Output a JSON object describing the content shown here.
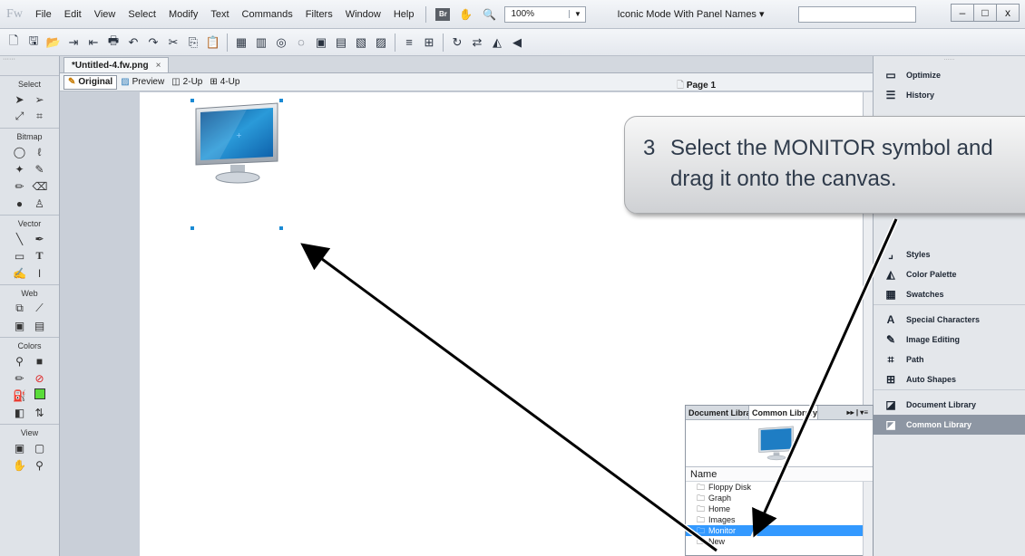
{
  "app": {
    "logo": "Fw"
  },
  "menu": [
    "File",
    "Edit",
    "View",
    "Select",
    "Modify",
    "Text",
    "Commands",
    "Filters",
    "Window",
    "Help"
  ],
  "menubar": {
    "bridge_label": "Br",
    "zoom": "100%",
    "workspace": "Iconic Mode With Panel Names"
  },
  "window_buttons": {
    "minimize": "–",
    "maximize": "□",
    "close": "x"
  },
  "document": {
    "tab_label": "*Untitled-4.fw.png",
    "tab_close": "×",
    "page": "Page 1"
  },
  "view_modes": [
    "Original",
    "Preview",
    "2-Up",
    "4-Up"
  ],
  "tools": {
    "sections": [
      {
        "title": "Select"
      },
      {
        "title": "Bitmap"
      },
      {
        "title": "Vector"
      },
      {
        "title": "Web"
      },
      {
        "title": "Colors"
      },
      {
        "title": "View"
      }
    ],
    "fill_color": "#5adc3a"
  },
  "right_panels": {
    "group1": [
      "Optimize",
      "History"
    ],
    "group2": [
      "Styles",
      "Color Palette",
      "Swatches"
    ],
    "group3": [
      "Special Characters",
      "Image Editing",
      "Path",
      "Auto Shapes"
    ],
    "group4": [
      "Document Library",
      "Common Library"
    ],
    "selected": "Common Library"
  },
  "library": {
    "tabs": [
      "Document Librar",
      "Common Library"
    ],
    "column": "Name",
    "items": [
      "Floppy Disk",
      "Graph",
      "Home",
      "Images",
      "Monitor",
      "New"
    ],
    "selected": "Monitor"
  },
  "callout": {
    "number": "3",
    "line1": "Select the MONITOR symbol and",
    "line2": "drag it onto the canvas."
  },
  "colors": {
    "selection": "#3399ff",
    "accent": "#1a8ad4"
  }
}
